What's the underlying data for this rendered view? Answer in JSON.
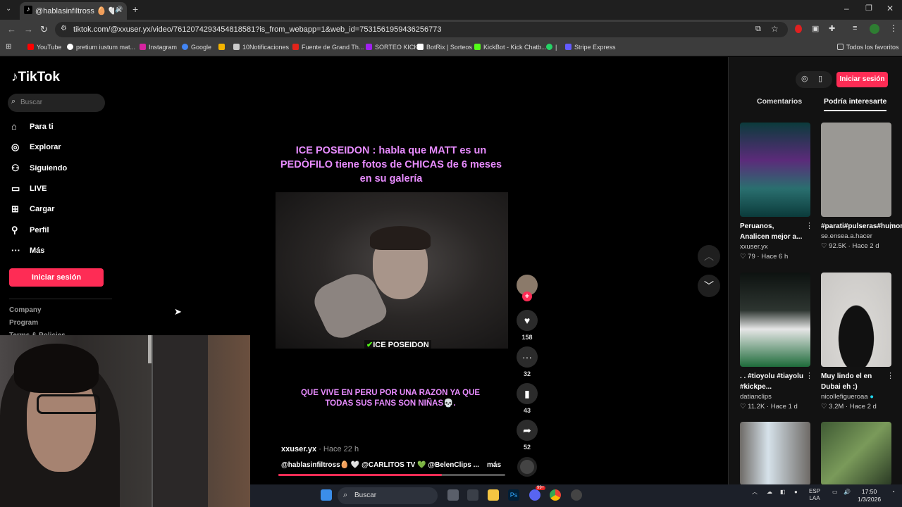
{
  "browser": {
    "tab_title": "@hablasinfiltross 🥚 🤍 @C",
    "url": "tiktok.com/@xxuser.yx/video/7612074293454818581?is_from_webapp=1&web_id=7531561959436256773",
    "bookmarks": [
      "YouTube",
      "pretium iustum mat...",
      "Instagram",
      "Google",
      "10Notificaciones",
      "Fuente de Grand Th...",
      "SORTEO KICK",
      "BotRix | Sorteos",
      "KickBot - Kick Chatb...",
      "Stripe Express"
    ],
    "all_bookmarks": "Todos los favoritos",
    "bookmark_colors": [
      "#ff0000",
      "#ffffff",
      "#d6249f",
      "#4285f4",
      "#cccccc",
      "#e2231a",
      "#a020f0",
      "#ffffff",
      "#53fc18",
      "#25d366",
      "#635bff"
    ]
  },
  "sidebar": {
    "logo": "TikTok",
    "search_placeholder": "Buscar",
    "nav": [
      "Para ti",
      "Explorar",
      "Siguiendo",
      "LIVE",
      "Cargar",
      "Perfil",
      "Más"
    ],
    "nav_icons": [
      "home-icon",
      "compass-icon",
      "following-icon",
      "live-icon",
      "upload-icon",
      "profile-icon",
      "more-icon"
    ],
    "login": "Iniciar sesión",
    "footer": [
      "Company",
      "Program",
      "Terms & Policies"
    ]
  },
  "video": {
    "caption_top": "ICE POSEIDON : habla que MATT  es un PEDÒFILO tiene fotos de CHICAS de 6 meses en su galería",
    "caption_bottom": "QUE VIVE EN PERU POR UNA RAZON YA QUE TODAS SUS FANS SON NIÑAS💀.",
    "watermark": "ICE POSEIDON",
    "author": "xxuser.yx",
    "time": " · Hace 22 h",
    "description": "@hablasinfiltross🥚 🤍 @CARLITOS TV 💚 @BelenClips ...",
    "more": "más",
    "progress": 0.72,
    "likes": "158",
    "comments": "32",
    "saves": "43",
    "shares": "52"
  },
  "right_panel": {
    "login": "Iniciar sesión",
    "tabs": [
      "Comentarios",
      "Podría interesarte"
    ],
    "cards": [
      {
        "title": "Peruanos, Analicen mejor a...",
        "user": "xxuser.yx",
        "likes": "79",
        "time": "Hace 6 h",
        "verified": false,
        "color": "#1f7a7a"
      },
      {
        "title": "#parati#pulseras#humor#humorrr",
        "user": "se.ensea.a.hacer",
        "likes": "92.5K",
        "time": "Hace 2 d",
        "verified": false,
        "color": "#9a9894"
      },
      {
        "title": ". . #tioyolu #tiayolu #kickpe...",
        "user": "datianclips",
        "likes": "11.2K",
        "time": "Hace 1 d",
        "verified": false,
        "color": "#2d3530"
      },
      {
        "title": "Muy lindo el en Dubai eh :)",
        "user": "nicollefigueroaa",
        "likes": "3.2M",
        "time": "Hace 2 d",
        "verified": true,
        "color": "#c9c7c4"
      },
      {
        "title": "",
        "user": "",
        "likes": "",
        "time": "",
        "verified": false,
        "color": "#6e6a66"
      },
      {
        "title": "",
        "user": "",
        "likes": "",
        "time": "",
        "verified": false,
        "color": "#3f5a34"
      }
    ]
  },
  "taskbar": {
    "search": "Buscar",
    "lang": "ESP",
    "region": "LAA",
    "time": "17:50",
    "date": "1/3/2026",
    "badge": "99+"
  }
}
